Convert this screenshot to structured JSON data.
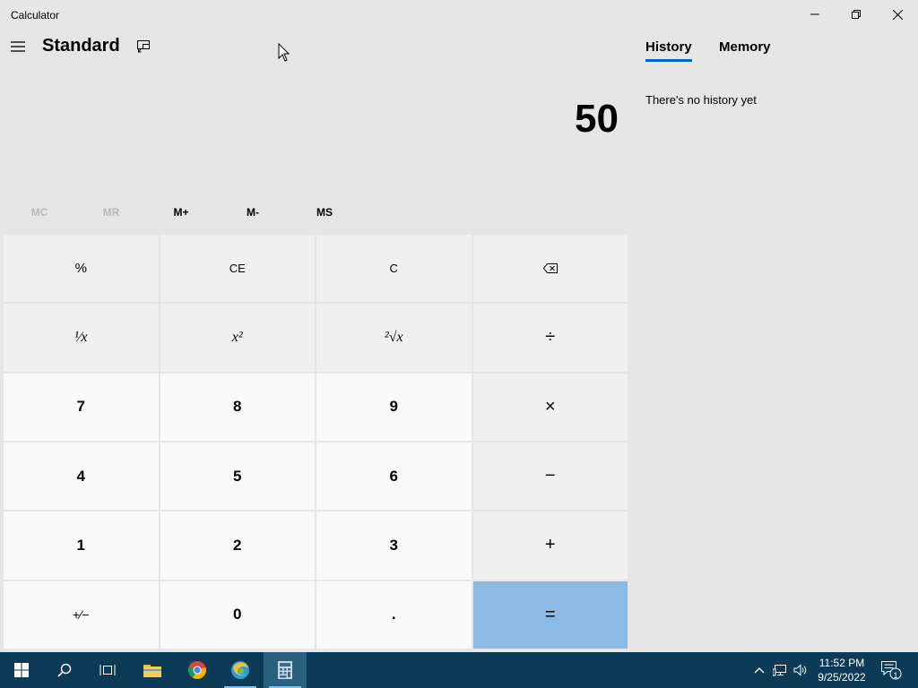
{
  "window": {
    "title": "Calculator",
    "controls": [
      "minimize-icon",
      "restore-icon",
      "close-icon"
    ]
  },
  "header": {
    "mode": "Standard",
    "menu_icon": "hamburger-icon",
    "keep_on_top_icon": "keep-on-top-icon"
  },
  "display": {
    "value": "50"
  },
  "memory": {
    "buttons": [
      {
        "label": "MC",
        "enabled": false
      },
      {
        "label": "MR",
        "enabled": false
      },
      {
        "label": "M+",
        "enabled": true
      },
      {
        "label": "M-",
        "enabled": true
      },
      {
        "label": "MS",
        "enabled": true
      }
    ]
  },
  "keypad": {
    "percent": "%",
    "ce": "CE",
    "c": "C",
    "backspace_icon": "backspace-icon",
    "reciprocal": "¹⁄x",
    "square": "x²",
    "sqrt": "²√x",
    "divide": "÷",
    "seven": "7",
    "eight": "8",
    "nine": "9",
    "multiply": "×",
    "four": "4",
    "five": "5",
    "six": "6",
    "minus": "−",
    "one": "1",
    "two": "2",
    "three": "3",
    "plus": "+",
    "negate": "+⁄−",
    "zero": "0",
    "decimal": ".",
    "equals": "="
  },
  "side_panel": {
    "tabs": [
      {
        "label": "History",
        "active": true
      },
      {
        "label": "Memory",
        "active": false
      }
    ],
    "history_empty": "There's no history yet"
  },
  "taskbar": {
    "items": [
      "start-icon",
      "search-icon",
      "task-view-icon",
      "file-explorer-icon",
      "chrome-icon",
      "edge-beta-icon",
      "calculator-icon"
    ],
    "clock": {
      "time": "11:52 PM",
      "date": "9/25/2022"
    },
    "notification_count": "1"
  },
  "colors": {
    "background": "#e6e6e6",
    "key_number": "#fafafa",
    "key_function": "#f0f0f0",
    "equals": "#8bbbe5",
    "accent": "#0067c0",
    "taskbar": "#0d3b57"
  }
}
